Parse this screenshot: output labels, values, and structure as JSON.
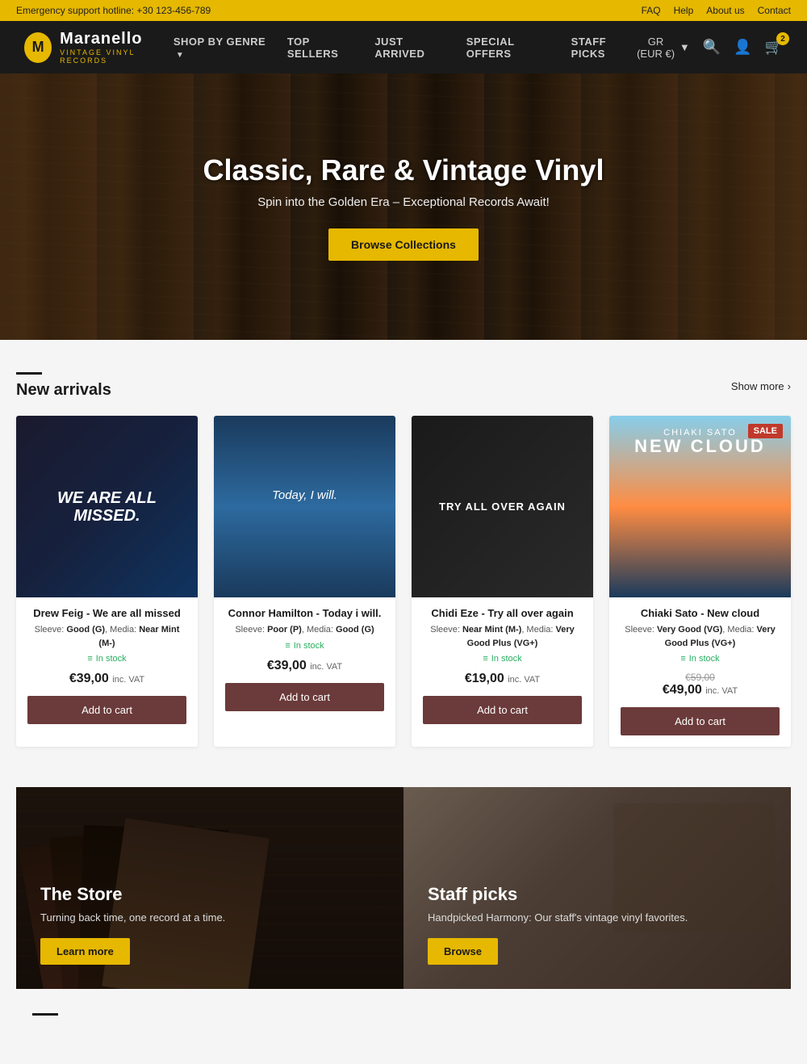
{
  "topbar": {
    "support": "Emergency support hotline: +30 123-456-789",
    "links": [
      "FAQ",
      "Help",
      "About us",
      "Contact"
    ]
  },
  "header": {
    "logo_initial": "M",
    "brand_name": "Maranello",
    "brand_sub": "VINTAGE VINYL RECORDS",
    "nav": [
      {
        "label": "SHOP BY GENRE",
        "has_dropdown": true
      },
      {
        "label": "TOP SELLERS",
        "has_dropdown": false
      },
      {
        "label": "JUST ARRIVED",
        "has_dropdown": false
      },
      {
        "label": "SPECIAL OFFERS",
        "has_dropdown": false
      },
      {
        "label": "STAFF PICKS",
        "has_dropdown": false
      }
    ],
    "currency": "GR (EUR €)",
    "cart_count": "2"
  },
  "hero": {
    "title": "Classic, Rare & Vintage Vinyl",
    "subtitle": "Spin into the Golden Era – Exceptional Records Await!",
    "cta_label": "Browse Collections"
  },
  "new_arrivals": {
    "section_title": "New arrivals",
    "show_more": "Show more",
    "products": [
      {
        "id": 1,
        "name": "Drew Feig - We are all missed",
        "sleeve": "Good (G)",
        "media": "Near Mint (M-)",
        "in_stock": "In stock",
        "price": "€39,00",
        "price_vat": "inc. VAT",
        "price_old": null,
        "sale": false,
        "add_to_cart": "Add to cart"
      },
      {
        "id": 2,
        "name": "Connor Hamilton - Today i will.",
        "sleeve": "Poor (P)",
        "media": "Good (G)",
        "in_stock": "In stock",
        "price": "€39,00",
        "price_vat": "inc. VAT",
        "price_old": null,
        "sale": false,
        "add_to_cart": "Add to cart"
      },
      {
        "id": 3,
        "name": "Chidi Eze - Try all over again",
        "sleeve": "Near Mint (M-)",
        "media": "Very Good Plus (VG+)",
        "in_stock": "In stock",
        "price": "€19,00",
        "price_vat": "inc. VAT",
        "price_old": null,
        "sale": false,
        "add_to_cart": "Add to cart"
      },
      {
        "id": 4,
        "name": "Chiaki Sato - New cloud",
        "sleeve": "Very Good (VG)",
        "media": "Very Good Plus (VG+)",
        "in_stock": "In stock",
        "price": "€49,00",
        "price_vat": "inc. VAT",
        "price_old": "€59,00",
        "sale": true,
        "add_to_cart": "Add to cart",
        "sale_label": "SALE"
      }
    ]
  },
  "banners": [
    {
      "id": "store",
      "title": "The Store",
      "subtitle": "Turning back time, one record at a time.",
      "cta": "Learn more"
    },
    {
      "id": "staff",
      "title": "Staff picks",
      "subtitle": "Handpicked Harmony: Our staff's vintage vinyl favorites.",
      "cta": "Browse"
    }
  ]
}
